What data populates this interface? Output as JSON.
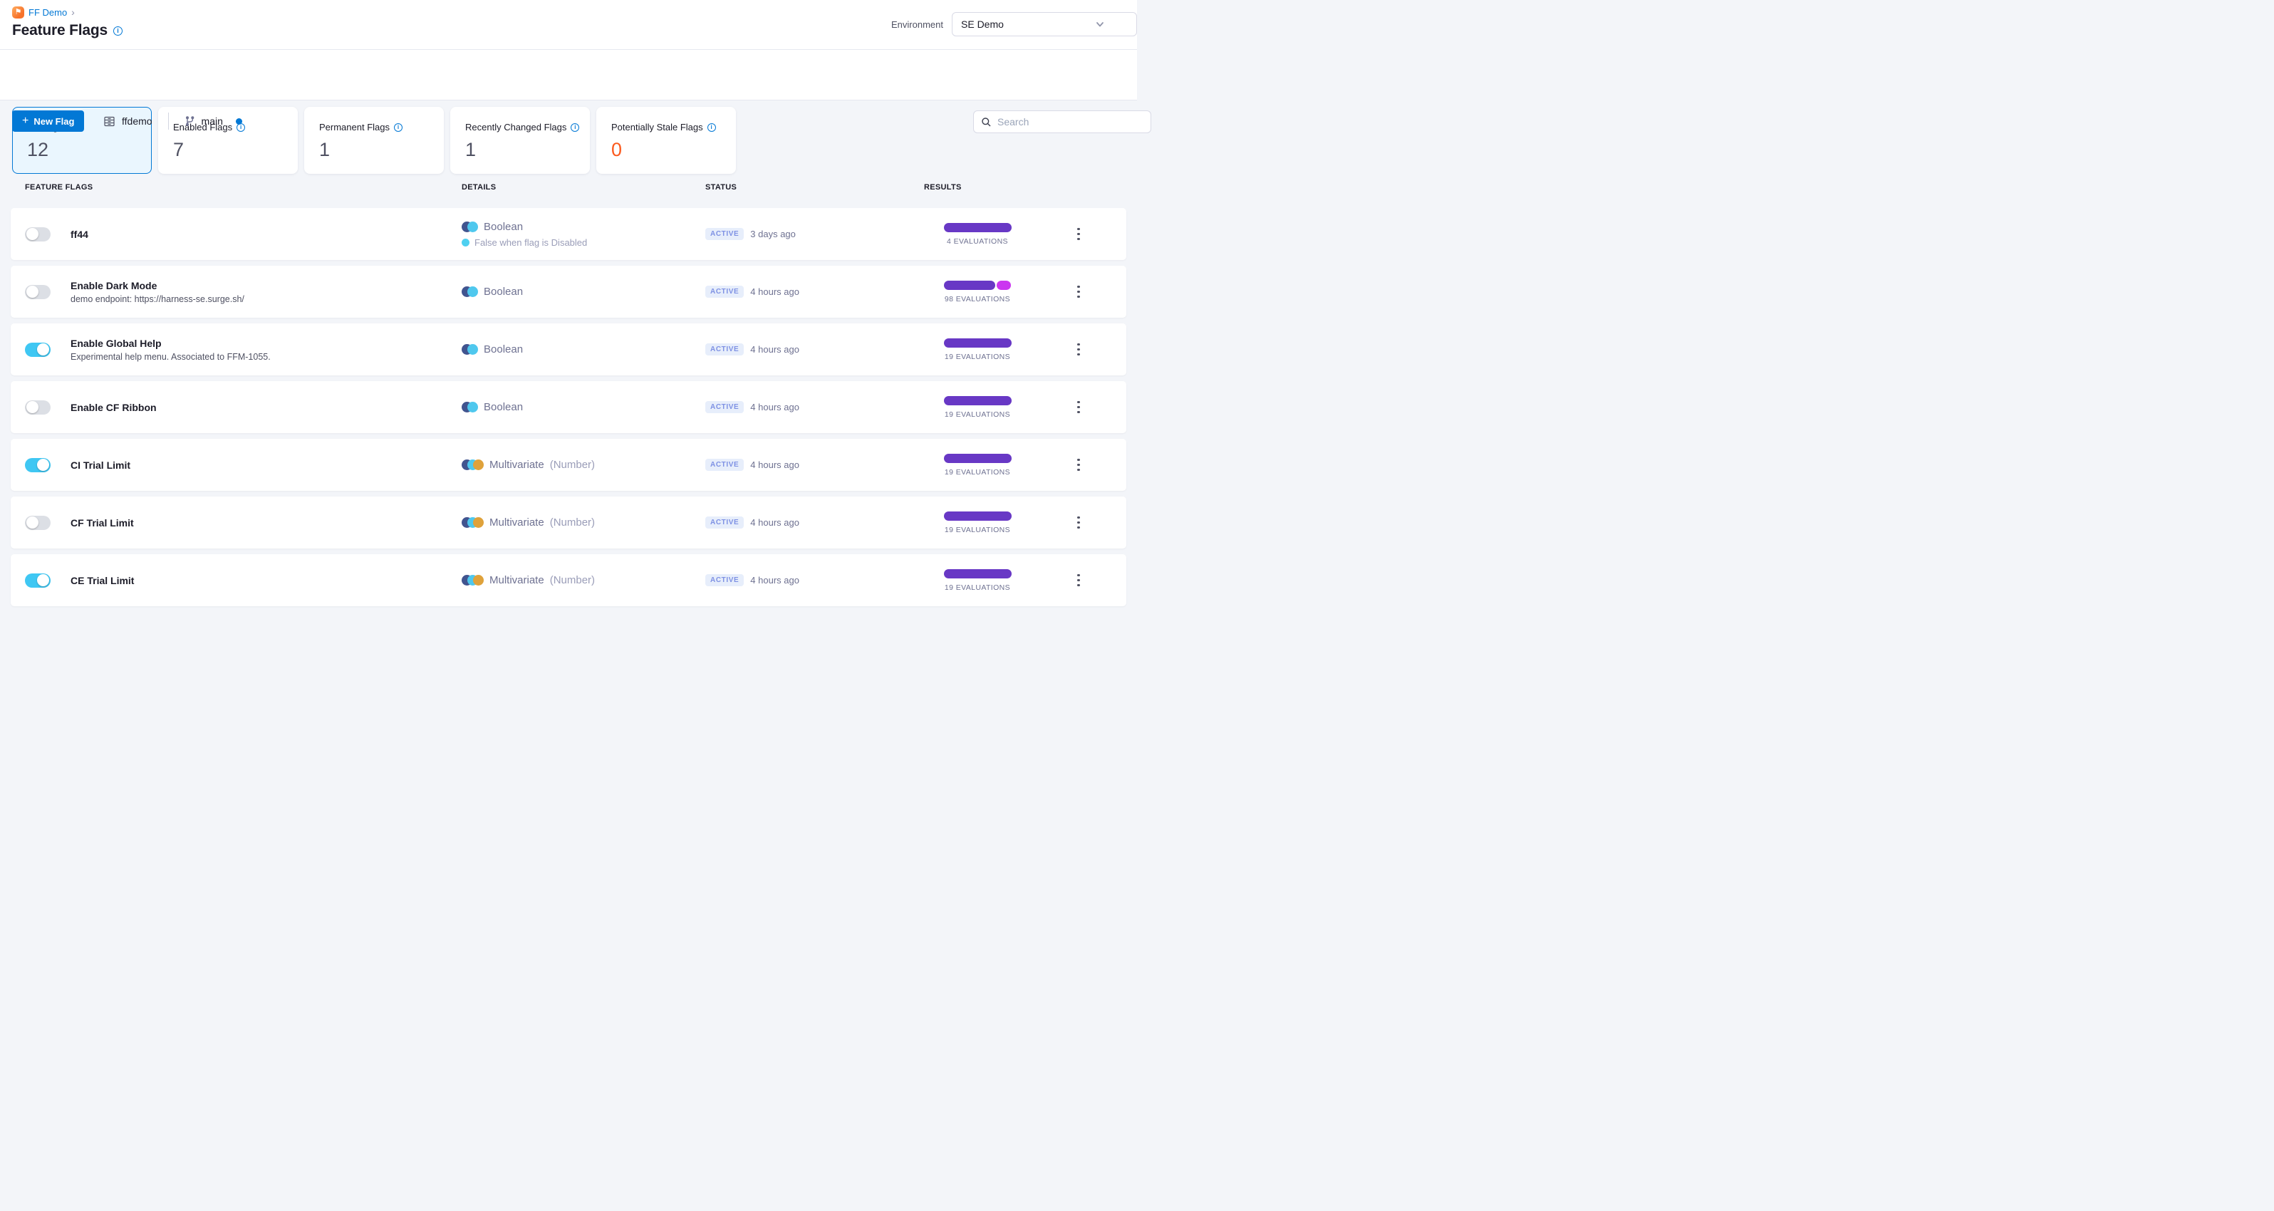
{
  "breadcrumb": {
    "project": "FF Demo",
    "chevron": "›"
  },
  "page": {
    "title": "Feature Flags"
  },
  "environment": {
    "label": "Environment",
    "value": "SE Demo"
  },
  "toolbar": {
    "new_flag_label": "New Flag",
    "plus": "+",
    "repo_name": "ffdemo",
    "branch_name": "main"
  },
  "search": {
    "placeholder": "Search"
  },
  "icons": {
    "module_flag": "⚑",
    "info": "i"
  },
  "colors": {
    "brand_blue": "#0278d5",
    "toggle_on": "#3fc7f3",
    "bar_purple": "#6838c5",
    "bar_magenta": "#cb36f0",
    "stale_orange": "#fb5a1e",
    "boolean_navy": "#41548f",
    "boolean_cyan": "#4fc8ee",
    "multivariate_gold": "#dfa23b"
  },
  "stats": [
    {
      "label": "All Flags",
      "value": "12",
      "info": false,
      "selected": true
    },
    {
      "label": "Enabled Flags",
      "value": "7",
      "info": true,
      "selected": false
    },
    {
      "label": "Permanent Flags",
      "value": "1",
      "info": true,
      "selected": false
    },
    {
      "label": "Recently Changed Flags",
      "value": "1",
      "info": true,
      "selected": false
    },
    {
      "label": "Potentially Stale Flags",
      "value": "0",
      "info": true,
      "selected": false,
      "value_color": "#fb5a1e"
    }
  ],
  "table": {
    "columns": {
      "flags": "FEATURE FLAGS",
      "details": "DETAILS",
      "status": "STATUS",
      "results": "RESULTS"
    }
  },
  "flags": [
    {
      "name": "ff44",
      "enabled": false,
      "description": "",
      "type": "Boolean",
      "type_suffix": "",
      "circles": [
        "#41548f",
        "#4fc8ee"
      ],
      "note": "False when flag is Disabled",
      "status": "ACTIVE",
      "updated": "3 days ago",
      "evaluations_label": "4 EVALUATIONS",
      "bar": [
        {
          "color": "#6838c5",
          "width": 95
        }
      ]
    },
    {
      "name": "Enable Dark Mode",
      "enabled": false,
      "description": "demo endpoint: https://harness-se.surge.sh/",
      "type": "Boolean",
      "type_suffix": "",
      "circles": [
        "#41548f",
        "#4fc8ee"
      ],
      "note": "",
      "status": "ACTIVE",
      "updated": "4 hours ago",
      "evaluations_label": "98 EVALUATIONS",
      "bar": [
        {
          "color": "#6838c5",
          "width": 72
        },
        {
          "color": "#cb36f0",
          "width": 20
        }
      ]
    },
    {
      "name": "Enable Global Help",
      "enabled": true,
      "description": "Experimental help menu. Associated to FFM-1055.",
      "type": "Boolean",
      "type_suffix": "",
      "circles": [
        "#41548f",
        "#4fc8ee"
      ],
      "note": "",
      "status": "ACTIVE",
      "updated": "4 hours ago",
      "evaluations_label": "19 EVALUATIONS",
      "bar": [
        {
          "color": "#6838c5",
          "width": 95
        }
      ]
    },
    {
      "name": "Enable CF Ribbon",
      "enabled": false,
      "description": "",
      "type": "Boolean",
      "type_suffix": "",
      "circles": [
        "#41548f",
        "#4fc8ee"
      ],
      "note": "",
      "status": "ACTIVE",
      "updated": "4 hours ago",
      "evaluations_label": "19 EVALUATIONS",
      "bar": [
        {
          "color": "#6838c5",
          "width": 95
        }
      ]
    },
    {
      "name": "CI Trial Limit",
      "enabled": true,
      "description": "",
      "type": "Multivariate",
      "type_suffix": "(Number)",
      "circles": [
        "#41548f",
        "#4fc8ee",
        "#dfa23b"
      ],
      "note": "",
      "status": "ACTIVE",
      "updated": "4 hours ago",
      "evaluations_label": "19 EVALUATIONS",
      "bar": [
        {
          "color": "#6838c5",
          "width": 95
        }
      ]
    },
    {
      "name": "CF Trial Limit",
      "enabled": false,
      "description": "",
      "type": "Multivariate",
      "type_suffix": "(Number)",
      "circles": [
        "#41548f",
        "#4fc8ee",
        "#dfa23b"
      ],
      "note": "",
      "status": "ACTIVE",
      "updated": "4 hours ago",
      "evaluations_label": "19 EVALUATIONS",
      "bar": [
        {
          "color": "#6838c5",
          "width": 95
        }
      ]
    },
    {
      "name": "CE Trial Limit",
      "enabled": true,
      "description": "",
      "type": "Multivariate",
      "type_suffix": "(Number)",
      "circles": [
        "#41548f",
        "#4fc8ee",
        "#dfa23b"
      ],
      "note": "",
      "status": "ACTIVE",
      "updated": "4 hours ago",
      "evaluations_label": "19 EVALUATIONS",
      "bar": [
        {
          "color": "#6838c5",
          "width": 95
        }
      ]
    }
  ]
}
